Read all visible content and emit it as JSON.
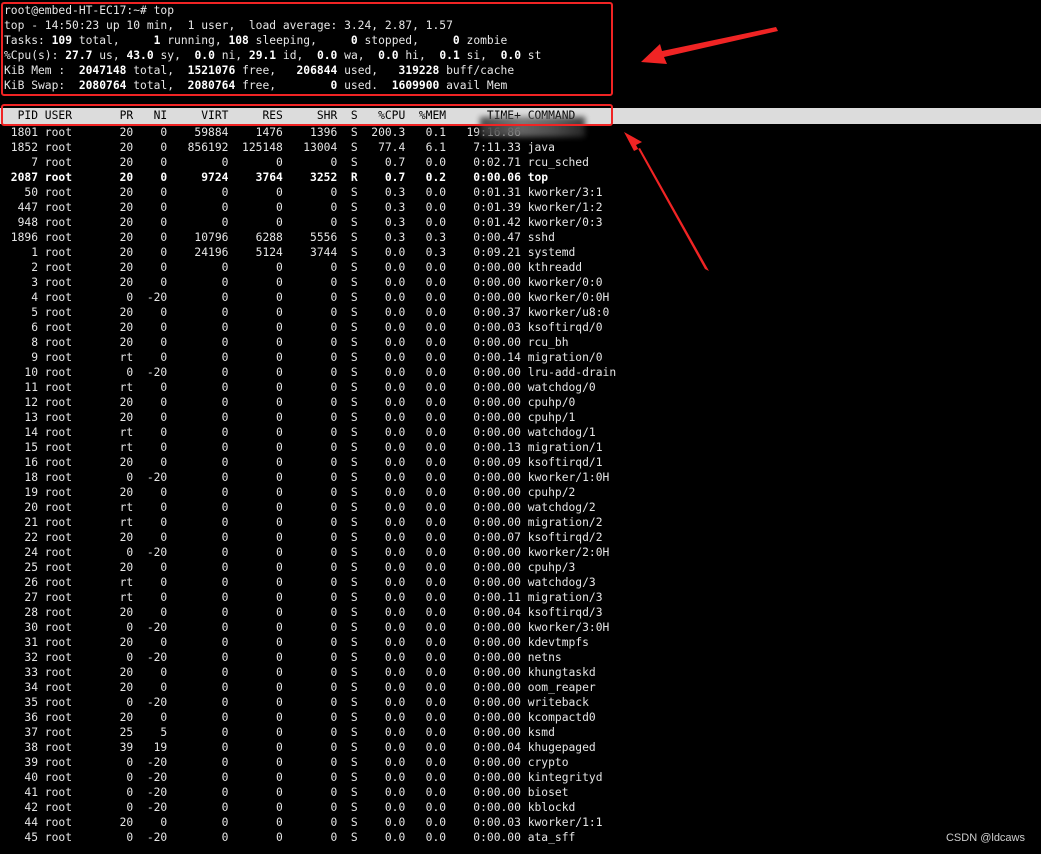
{
  "terminal": {
    "prompt": "root@embed-HT-EC17:~# top",
    "summary": [
      [
        {
          "t": "top - 14:50:23 up 10 min,  1 user,  load average: 3.24, 2.87, 1.57",
          "b": false
        }
      ],
      [
        {
          "t": "Tasks: ",
          "b": false
        },
        {
          "t": "109",
          "b": true
        },
        {
          "t": " total,   ",
          "b": false
        },
        {
          "t": "  1",
          "b": true
        },
        {
          "t": " running, ",
          "b": false
        },
        {
          "t": "108",
          "b": true
        },
        {
          "t": " sleeping,   ",
          "b": false
        },
        {
          "t": "  0",
          "b": true
        },
        {
          "t": " stopped,   ",
          "b": false
        },
        {
          "t": "  0",
          "b": true
        },
        {
          "t": " zombie",
          "b": false
        }
      ],
      [
        {
          "t": "%Cpu(s): ",
          "b": false
        },
        {
          "t": "27.7",
          "b": true
        },
        {
          "t": " us, ",
          "b": false
        },
        {
          "t": "43.0",
          "b": true
        },
        {
          "t": " sy,  ",
          "b": false
        },
        {
          "t": "0.0",
          "b": true
        },
        {
          "t": " ni, ",
          "b": false
        },
        {
          "t": "29.1",
          "b": true
        },
        {
          "t": " id,  ",
          "b": false
        },
        {
          "t": "0.0",
          "b": true
        },
        {
          "t": " wa,  ",
          "b": false
        },
        {
          "t": "0.0",
          "b": true
        },
        {
          "t": " hi,  ",
          "b": false
        },
        {
          "t": "0.1",
          "b": true
        },
        {
          "t": " si,  ",
          "b": false
        },
        {
          "t": "0.0",
          "b": true
        },
        {
          "t": " st",
          "b": false
        }
      ],
      [
        {
          "t": "KiB Mem :  ",
          "b": false
        },
        {
          "t": "2047148",
          "b": true
        },
        {
          "t": " total,  ",
          "b": false
        },
        {
          "t": "1521076",
          "b": true
        },
        {
          "t": " free,   ",
          "b": false
        },
        {
          "t": "206844",
          "b": true
        },
        {
          "t": " used,   ",
          "b": false
        },
        {
          "t": "319228",
          "b": true
        },
        {
          "t": " buff/cache",
          "b": false
        }
      ],
      [
        {
          "t": "KiB Swap:  ",
          "b": false
        },
        {
          "t": "2080764",
          "b": true
        },
        {
          "t": " total,  ",
          "b": false
        },
        {
          "t": "2080764",
          "b": true
        },
        {
          "t": " free,   ",
          "b": false
        },
        {
          "t": "     0",
          "b": true
        },
        {
          "t": " used.  ",
          "b": false
        },
        {
          "t": "1609900",
          "b": true
        },
        {
          "t": " avail Mem",
          "b": false
        }
      ]
    ],
    "columns": [
      "PID",
      "USER",
      "PR",
      "NI",
      "VIRT",
      "RES",
      "SHR",
      "S",
      "%CPU",
      "%MEM",
      "TIME+",
      "COMMAND"
    ],
    "processes": [
      {
        "pid": "1801",
        "user": "root",
        "pr": "20",
        "ni": "0",
        "virt": "59884",
        "res": "1476",
        "shr": "1396",
        "s": "S",
        "cpu": "200.3",
        "mem": "0.1",
        "time": "19:16.86",
        "cmd": "",
        "bold": false
      },
      {
        "pid": "1852",
        "user": "root",
        "pr": "20",
        "ni": "0",
        "virt": "856192",
        "res": "125148",
        "shr": "13004",
        "s": "S",
        "cpu": "77.4",
        "mem": "6.1",
        "time": "7:11.33",
        "cmd": "java",
        "bold": false
      },
      {
        "pid": "7",
        "user": "root",
        "pr": "20",
        "ni": "0",
        "virt": "0",
        "res": "0",
        "shr": "0",
        "s": "S",
        "cpu": "0.7",
        "mem": "0.0",
        "time": "0:02.71",
        "cmd": "rcu_sched",
        "bold": false
      },
      {
        "pid": "2087",
        "user": "root",
        "pr": "20",
        "ni": "0",
        "virt": "9724",
        "res": "3764",
        "shr": "3252",
        "s": "R",
        "cpu": "0.7",
        "mem": "0.2",
        "time": "0:00.06",
        "cmd": "top",
        "bold": true
      },
      {
        "pid": "50",
        "user": "root",
        "pr": "20",
        "ni": "0",
        "virt": "0",
        "res": "0",
        "shr": "0",
        "s": "S",
        "cpu": "0.3",
        "mem": "0.0",
        "time": "0:01.31",
        "cmd": "kworker/3:1",
        "bold": false
      },
      {
        "pid": "447",
        "user": "root",
        "pr": "20",
        "ni": "0",
        "virt": "0",
        "res": "0",
        "shr": "0",
        "s": "S",
        "cpu": "0.3",
        "mem": "0.0",
        "time": "0:01.39",
        "cmd": "kworker/1:2",
        "bold": false
      },
      {
        "pid": "948",
        "user": "root",
        "pr": "20",
        "ni": "0",
        "virt": "0",
        "res": "0",
        "shr": "0",
        "s": "S",
        "cpu": "0.3",
        "mem": "0.0",
        "time": "0:01.42",
        "cmd": "kworker/0:3",
        "bold": false
      },
      {
        "pid": "1896",
        "user": "root",
        "pr": "20",
        "ni": "0",
        "virt": "10796",
        "res": "6288",
        "shr": "5556",
        "s": "S",
        "cpu": "0.3",
        "mem": "0.3",
        "time": "0:00.47",
        "cmd": "sshd",
        "bold": false
      },
      {
        "pid": "1",
        "user": "root",
        "pr": "20",
        "ni": "0",
        "virt": "24196",
        "res": "5124",
        "shr": "3744",
        "s": "S",
        "cpu": "0.0",
        "mem": "0.3",
        "time": "0:09.21",
        "cmd": "systemd",
        "bold": false
      },
      {
        "pid": "2",
        "user": "root",
        "pr": "20",
        "ni": "0",
        "virt": "0",
        "res": "0",
        "shr": "0",
        "s": "S",
        "cpu": "0.0",
        "mem": "0.0",
        "time": "0:00.00",
        "cmd": "kthreadd",
        "bold": false
      },
      {
        "pid": "3",
        "user": "root",
        "pr": "20",
        "ni": "0",
        "virt": "0",
        "res": "0",
        "shr": "0",
        "s": "S",
        "cpu": "0.0",
        "mem": "0.0",
        "time": "0:00.00",
        "cmd": "kworker/0:0",
        "bold": false
      },
      {
        "pid": "4",
        "user": "root",
        "pr": "0",
        "ni": "-20",
        "virt": "0",
        "res": "0",
        "shr": "0",
        "s": "S",
        "cpu": "0.0",
        "mem": "0.0",
        "time": "0:00.00",
        "cmd": "kworker/0:0H",
        "bold": false
      },
      {
        "pid": "5",
        "user": "root",
        "pr": "20",
        "ni": "0",
        "virt": "0",
        "res": "0",
        "shr": "0",
        "s": "S",
        "cpu": "0.0",
        "mem": "0.0",
        "time": "0:00.37",
        "cmd": "kworker/u8:0",
        "bold": false
      },
      {
        "pid": "6",
        "user": "root",
        "pr": "20",
        "ni": "0",
        "virt": "0",
        "res": "0",
        "shr": "0",
        "s": "S",
        "cpu": "0.0",
        "mem": "0.0",
        "time": "0:00.03",
        "cmd": "ksoftirqd/0",
        "bold": false
      },
      {
        "pid": "8",
        "user": "root",
        "pr": "20",
        "ni": "0",
        "virt": "0",
        "res": "0",
        "shr": "0",
        "s": "S",
        "cpu": "0.0",
        "mem": "0.0",
        "time": "0:00.00",
        "cmd": "rcu_bh",
        "bold": false
      },
      {
        "pid": "9",
        "user": "root",
        "pr": "rt",
        "ni": "0",
        "virt": "0",
        "res": "0",
        "shr": "0",
        "s": "S",
        "cpu": "0.0",
        "mem": "0.0",
        "time": "0:00.14",
        "cmd": "migration/0",
        "bold": false
      },
      {
        "pid": "10",
        "user": "root",
        "pr": "0",
        "ni": "-20",
        "virt": "0",
        "res": "0",
        "shr": "0",
        "s": "S",
        "cpu": "0.0",
        "mem": "0.0",
        "time": "0:00.00",
        "cmd": "lru-add-drain",
        "bold": false
      },
      {
        "pid": "11",
        "user": "root",
        "pr": "rt",
        "ni": "0",
        "virt": "0",
        "res": "0",
        "shr": "0",
        "s": "S",
        "cpu": "0.0",
        "mem": "0.0",
        "time": "0:00.00",
        "cmd": "watchdog/0",
        "bold": false
      },
      {
        "pid": "12",
        "user": "root",
        "pr": "20",
        "ni": "0",
        "virt": "0",
        "res": "0",
        "shr": "0",
        "s": "S",
        "cpu": "0.0",
        "mem": "0.0",
        "time": "0:00.00",
        "cmd": "cpuhp/0",
        "bold": false
      },
      {
        "pid": "13",
        "user": "root",
        "pr": "20",
        "ni": "0",
        "virt": "0",
        "res": "0",
        "shr": "0",
        "s": "S",
        "cpu": "0.0",
        "mem": "0.0",
        "time": "0:00.00",
        "cmd": "cpuhp/1",
        "bold": false
      },
      {
        "pid": "14",
        "user": "root",
        "pr": "rt",
        "ni": "0",
        "virt": "0",
        "res": "0",
        "shr": "0",
        "s": "S",
        "cpu": "0.0",
        "mem": "0.0",
        "time": "0:00.00",
        "cmd": "watchdog/1",
        "bold": false
      },
      {
        "pid": "15",
        "user": "root",
        "pr": "rt",
        "ni": "0",
        "virt": "0",
        "res": "0",
        "shr": "0",
        "s": "S",
        "cpu": "0.0",
        "mem": "0.0",
        "time": "0:00.13",
        "cmd": "migration/1",
        "bold": false
      },
      {
        "pid": "16",
        "user": "root",
        "pr": "20",
        "ni": "0",
        "virt": "0",
        "res": "0",
        "shr": "0",
        "s": "S",
        "cpu": "0.0",
        "mem": "0.0",
        "time": "0:00.09",
        "cmd": "ksoftirqd/1",
        "bold": false
      },
      {
        "pid": "18",
        "user": "root",
        "pr": "0",
        "ni": "-20",
        "virt": "0",
        "res": "0",
        "shr": "0",
        "s": "S",
        "cpu": "0.0",
        "mem": "0.0",
        "time": "0:00.00",
        "cmd": "kworker/1:0H",
        "bold": false
      },
      {
        "pid": "19",
        "user": "root",
        "pr": "20",
        "ni": "0",
        "virt": "0",
        "res": "0",
        "shr": "0",
        "s": "S",
        "cpu": "0.0",
        "mem": "0.0",
        "time": "0:00.00",
        "cmd": "cpuhp/2",
        "bold": false
      },
      {
        "pid": "20",
        "user": "root",
        "pr": "rt",
        "ni": "0",
        "virt": "0",
        "res": "0",
        "shr": "0",
        "s": "S",
        "cpu": "0.0",
        "mem": "0.0",
        "time": "0:00.00",
        "cmd": "watchdog/2",
        "bold": false
      },
      {
        "pid": "21",
        "user": "root",
        "pr": "rt",
        "ni": "0",
        "virt": "0",
        "res": "0",
        "shr": "0",
        "s": "S",
        "cpu": "0.0",
        "mem": "0.0",
        "time": "0:00.00",
        "cmd": "migration/2",
        "bold": false
      },
      {
        "pid": "22",
        "user": "root",
        "pr": "20",
        "ni": "0",
        "virt": "0",
        "res": "0",
        "shr": "0",
        "s": "S",
        "cpu": "0.0",
        "mem": "0.0",
        "time": "0:00.07",
        "cmd": "ksoftirqd/2",
        "bold": false
      },
      {
        "pid": "24",
        "user": "root",
        "pr": "0",
        "ni": "-20",
        "virt": "0",
        "res": "0",
        "shr": "0",
        "s": "S",
        "cpu": "0.0",
        "mem": "0.0",
        "time": "0:00.00",
        "cmd": "kworker/2:0H",
        "bold": false
      },
      {
        "pid": "25",
        "user": "root",
        "pr": "20",
        "ni": "0",
        "virt": "0",
        "res": "0",
        "shr": "0",
        "s": "S",
        "cpu": "0.0",
        "mem": "0.0",
        "time": "0:00.00",
        "cmd": "cpuhp/3",
        "bold": false
      },
      {
        "pid": "26",
        "user": "root",
        "pr": "rt",
        "ni": "0",
        "virt": "0",
        "res": "0",
        "shr": "0",
        "s": "S",
        "cpu": "0.0",
        "mem": "0.0",
        "time": "0:00.00",
        "cmd": "watchdog/3",
        "bold": false
      },
      {
        "pid": "27",
        "user": "root",
        "pr": "rt",
        "ni": "0",
        "virt": "0",
        "res": "0",
        "shr": "0",
        "s": "S",
        "cpu": "0.0",
        "mem": "0.0",
        "time": "0:00.11",
        "cmd": "migration/3",
        "bold": false
      },
      {
        "pid": "28",
        "user": "root",
        "pr": "20",
        "ni": "0",
        "virt": "0",
        "res": "0",
        "shr": "0",
        "s": "S",
        "cpu": "0.0",
        "mem": "0.0",
        "time": "0:00.04",
        "cmd": "ksoftirqd/3",
        "bold": false
      },
      {
        "pid": "30",
        "user": "root",
        "pr": "0",
        "ni": "-20",
        "virt": "0",
        "res": "0",
        "shr": "0",
        "s": "S",
        "cpu": "0.0",
        "mem": "0.0",
        "time": "0:00.00",
        "cmd": "kworker/3:0H",
        "bold": false
      },
      {
        "pid": "31",
        "user": "root",
        "pr": "20",
        "ni": "0",
        "virt": "0",
        "res": "0",
        "shr": "0",
        "s": "S",
        "cpu": "0.0",
        "mem": "0.0",
        "time": "0:00.00",
        "cmd": "kdevtmpfs",
        "bold": false
      },
      {
        "pid": "32",
        "user": "root",
        "pr": "0",
        "ni": "-20",
        "virt": "0",
        "res": "0",
        "shr": "0",
        "s": "S",
        "cpu": "0.0",
        "mem": "0.0",
        "time": "0:00.00",
        "cmd": "netns",
        "bold": false
      },
      {
        "pid": "33",
        "user": "root",
        "pr": "20",
        "ni": "0",
        "virt": "0",
        "res": "0",
        "shr": "0",
        "s": "S",
        "cpu": "0.0",
        "mem": "0.0",
        "time": "0:00.00",
        "cmd": "khungtaskd",
        "bold": false
      },
      {
        "pid": "34",
        "user": "root",
        "pr": "20",
        "ni": "0",
        "virt": "0",
        "res": "0",
        "shr": "0",
        "s": "S",
        "cpu": "0.0",
        "mem": "0.0",
        "time": "0:00.00",
        "cmd": "oom_reaper",
        "bold": false
      },
      {
        "pid": "35",
        "user": "root",
        "pr": "0",
        "ni": "-20",
        "virt": "0",
        "res": "0",
        "shr": "0",
        "s": "S",
        "cpu": "0.0",
        "mem": "0.0",
        "time": "0:00.00",
        "cmd": "writeback",
        "bold": false
      },
      {
        "pid": "36",
        "user": "root",
        "pr": "20",
        "ni": "0",
        "virt": "0",
        "res": "0",
        "shr": "0",
        "s": "S",
        "cpu": "0.0",
        "mem": "0.0",
        "time": "0:00.00",
        "cmd": "kcompactd0",
        "bold": false
      },
      {
        "pid": "37",
        "user": "root",
        "pr": "25",
        "ni": "5",
        "virt": "0",
        "res": "0",
        "shr": "0",
        "s": "S",
        "cpu": "0.0",
        "mem": "0.0",
        "time": "0:00.00",
        "cmd": "ksmd",
        "bold": false
      },
      {
        "pid": "38",
        "user": "root",
        "pr": "39",
        "ni": "19",
        "virt": "0",
        "res": "0",
        "shr": "0",
        "s": "S",
        "cpu": "0.0",
        "mem": "0.0",
        "time": "0:00.04",
        "cmd": "khugepaged",
        "bold": false
      },
      {
        "pid": "39",
        "user": "root",
        "pr": "0",
        "ni": "-20",
        "virt": "0",
        "res": "0",
        "shr": "0",
        "s": "S",
        "cpu": "0.0",
        "mem": "0.0",
        "time": "0:00.00",
        "cmd": "crypto",
        "bold": false
      },
      {
        "pid": "40",
        "user": "root",
        "pr": "0",
        "ni": "-20",
        "virt": "0",
        "res": "0",
        "shr": "0",
        "s": "S",
        "cpu": "0.0",
        "mem": "0.0",
        "time": "0:00.00",
        "cmd": "kintegrityd",
        "bold": false
      },
      {
        "pid": "41",
        "user": "root",
        "pr": "0",
        "ni": "-20",
        "virt": "0",
        "res": "0",
        "shr": "0",
        "s": "S",
        "cpu": "0.0",
        "mem": "0.0",
        "time": "0:00.00",
        "cmd": "bioset",
        "bold": false
      },
      {
        "pid": "42",
        "user": "root",
        "pr": "0",
        "ni": "-20",
        "virt": "0",
        "res": "0",
        "shr": "0",
        "s": "S",
        "cpu": "0.0",
        "mem": "0.0",
        "time": "0:00.00",
        "cmd": "kblockd",
        "bold": false
      },
      {
        "pid": "44",
        "user": "root",
        "pr": "20",
        "ni": "0",
        "virt": "0",
        "res": "0",
        "shr": "0",
        "s": "S",
        "cpu": "0.0",
        "mem": "0.0",
        "time": "0:00.03",
        "cmd": "kworker/1:1",
        "bold": false
      },
      {
        "pid": "45",
        "user": "root",
        "pr": "0",
        "ni": "-20",
        "virt": "0",
        "res": "0",
        "shr": "0",
        "s": "S",
        "cpu": "0.0",
        "mem": "0.0",
        "time": "0:00.00",
        "cmd": "ata_sff",
        "bold": false
      }
    ]
  },
  "annotations": {
    "color": "#f02424"
  },
  "watermark": "CSDN @ldcaws"
}
